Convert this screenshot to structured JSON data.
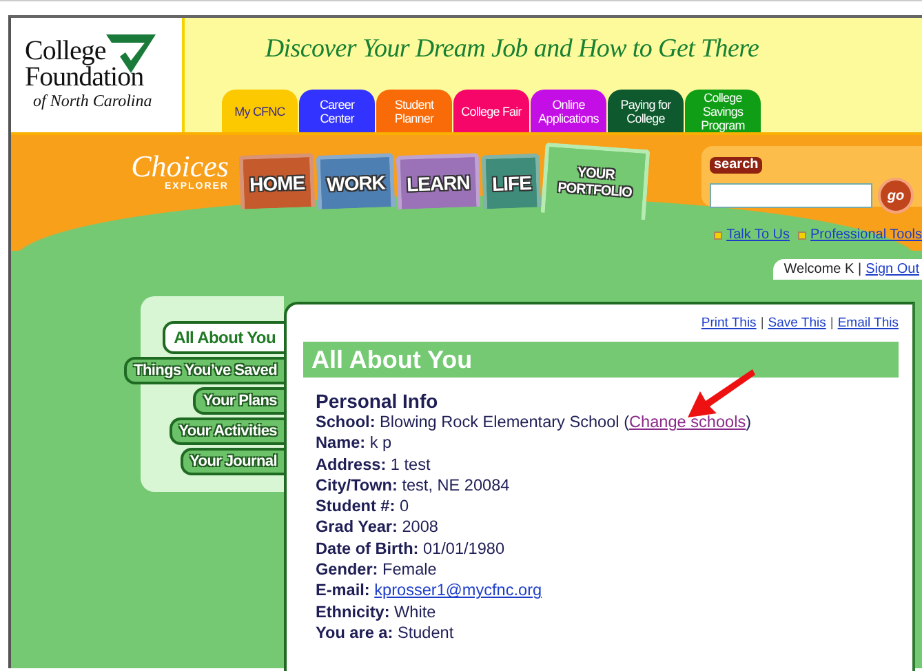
{
  "header": {
    "logo": {
      "line_1": "College",
      "line_2": "Foundation",
      "line_3": "of North Carolina"
    },
    "tagline": "Discover Your Dream Job and How to Get There",
    "site_tabs": [
      {
        "label": "My CFNC",
        "color": "#fcc800"
      },
      {
        "label": "Career Center",
        "color": "#3333ff"
      },
      {
        "label": "Student Planner",
        "color": "#f96b09"
      },
      {
        "label": "College Fair",
        "color": "#f7066a"
      },
      {
        "label": "Online Applications",
        "color": "#c40ee6"
      },
      {
        "label": "Paying for College",
        "color": "#0e5a2e"
      },
      {
        "label": "College Savings Program",
        "color": "#109e16"
      }
    ]
  },
  "nav": {
    "logo": {
      "name": "Choices",
      "sub": "EXPLORER"
    },
    "tabs": [
      {
        "label": "HOME",
        "color": "#c55a2c",
        "selected": false
      },
      {
        "label": "WORK",
        "color": "#4d7fb3",
        "selected": false
      },
      {
        "label": "LEARN",
        "color": "#9b72b8",
        "selected": false
      },
      {
        "label": "LIFE",
        "color": "#3e8c79",
        "selected": false
      },
      {
        "label": "YOUR PORTFOLIO",
        "color": "#74c972",
        "selected": true
      }
    ],
    "search": {
      "label": "search",
      "button": "go"
    },
    "links": [
      "Talk To Us",
      "Professional Tools"
    ]
  },
  "user": {
    "welcome": "Welcome K |",
    "sign_out": "Sign Out"
  },
  "side_tabs": [
    {
      "label": "All About You",
      "selected": true
    },
    {
      "label": "Things You’ve Saved",
      "selected": false
    },
    {
      "label": "Your Plans",
      "selected": false
    },
    {
      "label": "Your Activities",
      "selected": false
    },
    {
      "label": "Your Journal",
      "selected": false
    }
  ],
  "card": {
    "actions": [
      "Print This",
      "Save This",
      "Email This"
    ],
    "separator": "|",
    "title": "All About You",
    "section": "Personal Info",
    "fields": [
      {
        "kind": "school",
        "label": "School:",
        "value": "Blowing Rock Elementary School (",
        "link": "Change schools",
        "suffix": ")"
      },
      {
        "kind": "text",
        "label": "Name:",
        "value": "k p"
      },
      {
        "kind": "text",
        "label": "Address:",
        "value": "1 test"
      },
      {
        "kind": "text",
        "label": "City/Town:",
        "value": "test, NE 20084"
      },
      {
        "kind": "text",
        "label": "Student #:",
        "value": "0"
      },
      {
        "kind": "text",
        "label": "Grad Year:",
        "value": "2008"
      },
      {
        "kind": "text",
        "label": "Date of Birth:",
        "value": "01/01/1980"
      },
      {
        "kind": "text",
        "label": "Gender:",
        "value": "Female"
      },
      {
        "kind": "email",
        "label": "E-mail:",
        "value": "kprosser1@mycfnc.org"
      },
      {
        "kind": "text",
        "label": "Ethnicity:",
        "value": "White"
      },
      {
        "kind": "text",
        "label": "You are a:",
        "value": "Student"
      }
    ]
  }
}
